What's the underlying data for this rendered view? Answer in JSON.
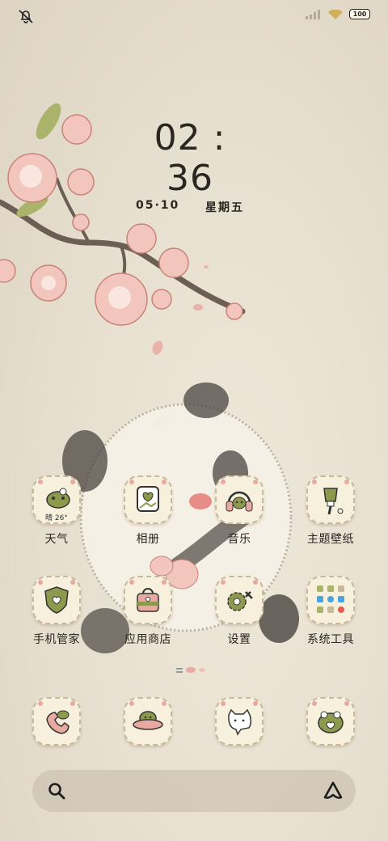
{
  "status_bar": {
    "battery": "100"
  },
  "clock": {
    "time": "02 : 36",
    "date": "05·10",
    "weekday": "星期五"
  },
  "weather": {
    "temp": "晴 26°"
  },
  "apps": [
    {
      "label": "天气"
    },
    {
      "label": "相册"
    },
    {
      "label": "音乐"
    },
    {
      "label": "主题壁纸"
    },
    {
      "label": "手机管家"
    },
    {
      "label": "应用商店"
    },
    {
      "label": "设置"
    },
    {
      "label": "系统工具"
    }
  ],
  "colors": {
    "accent_green": "#8d9a4e",
    "petal_pink": "#e8a9a0",
    "icon_bg": "#f7f0dd"
  }
}
